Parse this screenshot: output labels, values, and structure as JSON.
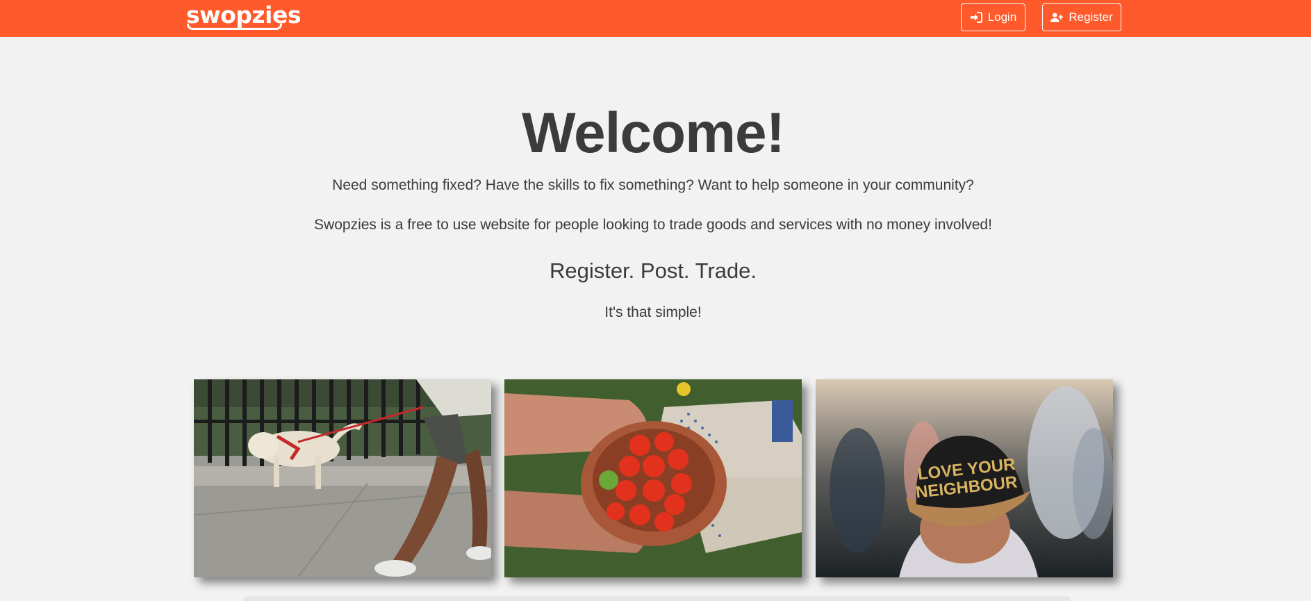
{
  "brand": {
    "name": "swopzies",
    "color": "#ff5a2b"
  },
  "nav": {
    "login_label": "Login",
    "register_label": "Register",
    "login_icon": "sign-in-icon",
    "register_icon": "user-plus-icon"
  },
  "hero": {
    "title": "Welcome!",
    "line1": "Need something fixed? Have the skills to fix something? Want to help someone in your community?",
    "line2": "Swopzies is a free to use website for people looking to trade goods and services with no money involved!",
    "slogan": "Register. Post. Trade.",
    "subslogan": "It's that simple!"
  },
  "photos": [
    {
      "name": "dog-walking-photo"
    },
    {
      "name": "tomatoes-bowl-photo"
    },
    {
      "name": "love-your-neighbour-photo",
      "cap_text_line1": "LOVE YOUR",
      "cap_text_line2": "NEIGHBOUR"
    }
  ]
}
